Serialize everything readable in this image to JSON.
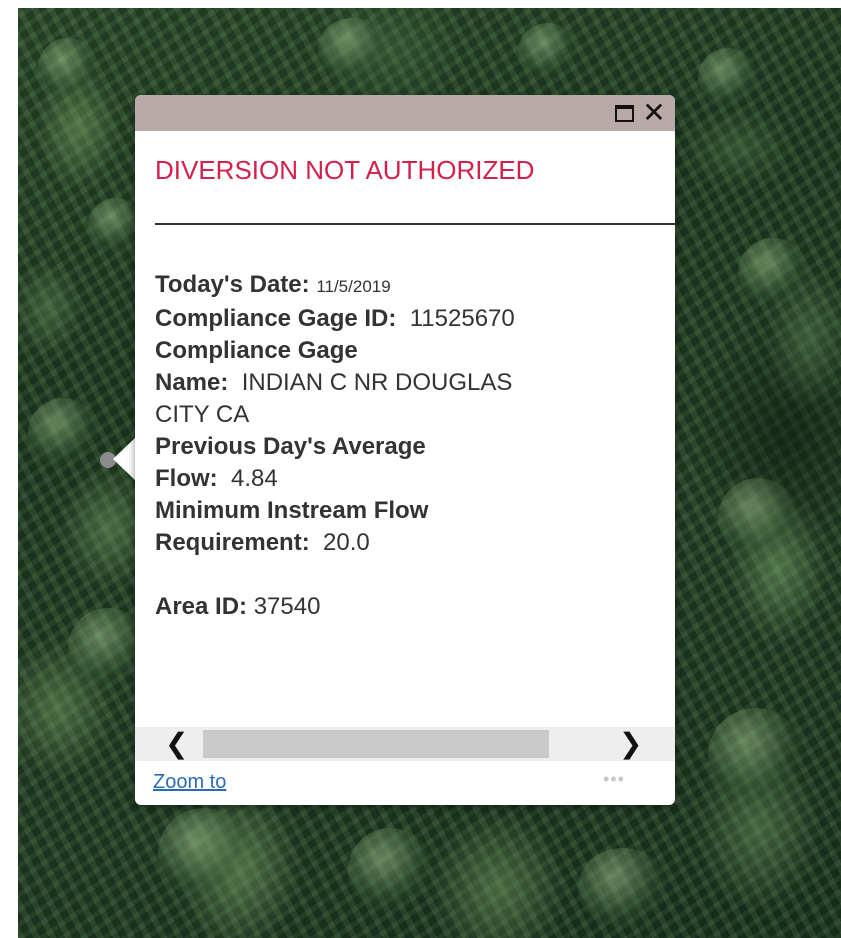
{
  "popup": {
    "title": "DIVERSION NOT AUTHORIZED",
    "title_color": "#d2214b",
    "titlebar_color": "#b8aaa6",
    "fields": {
      "todays_date_label": "Today's Date:",
      "todays_date_value": "11/5/2019",
      "gage_id_label": "Compliance Gage ID:",
      "gage_id_value": "11525670",
      "gage_name_label_line1": "Compliance Gage",
      "gage_name_label_line2": "Name:",
      "gage_name_value_line1": "INDIAN C NR DOUGLAS",
      "gage_name_value_line2": "CITY CA",
      "prev_flow_label_line1": "Previous Day's Average",
      "prev_flow_label_line2": "Flow:",
      "prev_flow_value": "4.84",
      "min_flow_label_line1": "Minimum Instream Flow",
      "min_flow_label_line2": "Requirement:",
      "min_flow_value": "20.0",
      "area_id_label": "Area ID:",
      "area_id_value": "37540"
    },
    "scrollbar": {
      "left_arrow": "❮",
      "right_arrow": "❯"
    },
    "footer": {
      "zoom_label": "Zoom to",
      "more_label": "•••",
      "link_color": "#2a6bb5"
    },
    "window_buttons": {
      "maximize_icon": "maximize-icon",
      "close_glyph": "✕"
    }
  }
}
